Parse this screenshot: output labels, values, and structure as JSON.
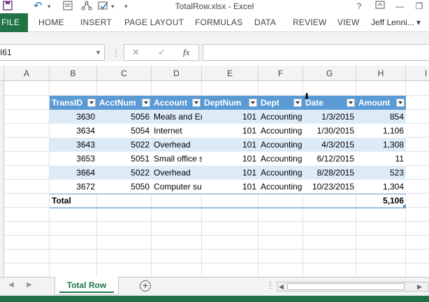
{
  "window": {
    "title": "TotalRow.xlsx - Excel",
    "help": "?",
    "minimize": "—",
    "restore": "❐"
  },
  "ribbon": {
    "tabs": [
      "FILE",
      "HOME",
      "INSERT",
      "PAGE LAYOUT",
      "FORMULAS",
      "DATA",
      "REVIEW",
      "VIEW"
    ],
    "user": "Jeff Lenni..."
  },
  "formula_bar": {
    "name_box": "I61",
    "cancel": "✕",
    "enter": "✓",
    "fx": "fx",
    "value": ""
  },
  "columns": [
    "A",
    "B",
    "C",
    "D",
    "E",
    "F",
    "G",
    "H",
    "I"
  ],
  "table": {
    "headers": [
      "TransID",
      "AcctNum",
      "Account",
      "DeptNum",
      "Dept",
      "Date",
      "Amount"
    ],
    "rows": [
      [
        "3630",
        "5056",
        "Meals and Entertainment",
        "101",
        "Accounting",
        "1/3/2015",
        "854"
      ],
      [
        "3634",
        "5054",
        "Internet",
        "101",
        "Accounting",
        "1/30/2015",
        "1,106"
      ],
      [
        "3643",
        "5022",
        "Overhead",
        "101",
        "Accounting",
        "4/3/2015",
        "1,308"
      ],
      [
        "3653",
        "5051",
        "Small office supplies",
        "101",
        "Accounting",
        "6/12/2015",
        "11"
      ],
      [
        "3664",
        "5022",
        "Overhead",
        "101",
        "Accounting",
        "8/28/2015",
        "523"
      ],
      [
        "3672",
        "5050",
        "Computer supplies",
        "101",
        "Accounting",
        "10/23/2015",
        "1,304"
      ]
    ],
    "total_label": "Total",
    "total_value": "5,106"
  },
  "sheets": {
    "active": "Total Row"
  },
  "colors": {
    "accent": "#217346",
    "table_header": "#5b9bd5",
    "band": "#ddebf7"
  }
}
